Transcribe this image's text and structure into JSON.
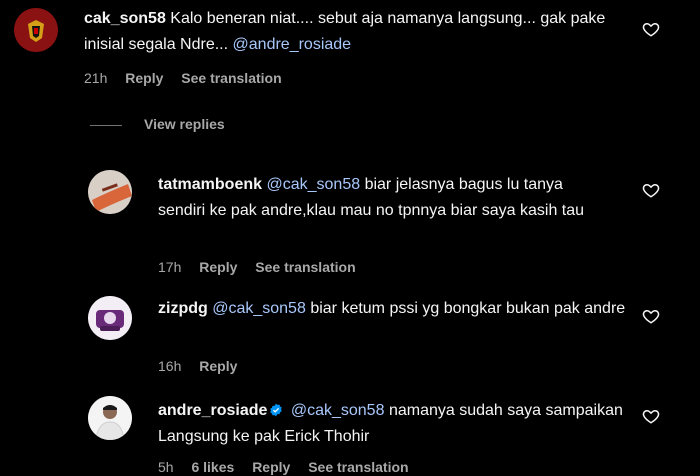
{
  "comments": [
    {
      "username": "cak_son58",
      "text": "Kalo beneran niat.... sebut aja namanya langsung... gak pake inisial segala Ndre...",
      "mention": "@andre_rosiade",
      "time": "21h",
      "reply_label": "Reply",
      "translate_label": "See translation"
    }
  ],
  "view_replies_label": "View replies",
  "replies": [
    {
      "username": "tatmamboenk",
      "mention": "@cak_son58",
      "text": "biar jelasnya bagus lu tanya sendiri ke pak andre,klau mau no tpnnya biar saya kasih tau",
      "time": "17h",
      "reply_label": "Reply",
      "translate_label": "See translation"
    },
    {
      "username": "zizpdg",
      "mention": "@cak_son58",
      "text": "biar ketum pssi yg bongkar bukan pak andre",
      "time": "16h",
      "reply_label": "Reply"
    },
    {
      "username": "andre_rosiade",
      "verified": true,
      "mention": "@cak_son58",
      "text": "namanya sudah saya sampaikan Langsung ke pak Erick Thohir",
      "time": "5h",
      "likes": "6 likes",
      "reply_label": "Reply",
      "translate_label": "See translation"
    }
  ],
  "colors": {
    "background": "#000000",
    "mention": "#a8c7fa",
    "meta": "#a8a8a8",
    "verified": "#0095f6"
  },
  "icons": [
    "heart-icon",
    "verified-badge-icon"
  ]
}
